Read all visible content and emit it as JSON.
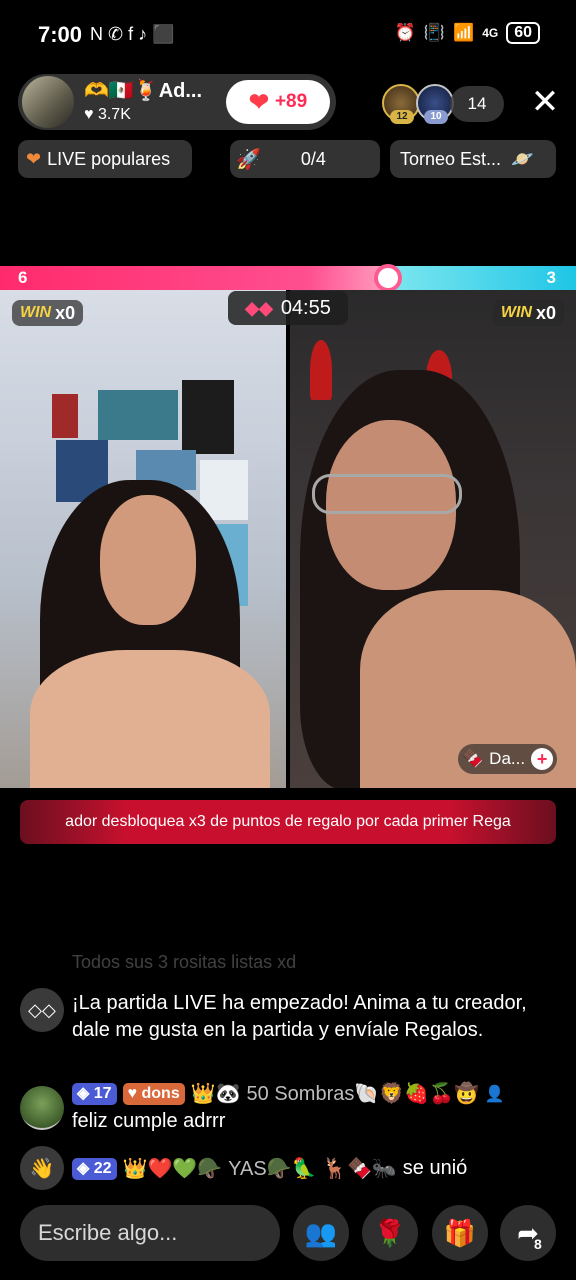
{
  "status_bar": {
    "time": "7:00",
    "left_icons": "N ✆ f ♪ ⬛",
    "network": "4G",
    "battery": "60"
  },
  "host": {
    "name": "🫶🇲🇽🍹Ad...",
    "likes": "♥ 3.7K",
    "follow_count": "+89"
  },
  "viewers": {
    "badge_1": "12",
    "badge_2": "10",
    "count": "14"
  },
  "chips": {
    "live_popular": "LIVE populares",
    "progress": "0/4",
    "tournament": "Torneo Est..."
  },
  "battle": {
    "score_left": "6",
    "score_right": "3",
    "timer": "04:55",
    "win_label": "WIN",
    "left_win": "x0",
    "right_win": "x0",
    "gifter_name": "Da..."
  },
  "banner": {
    "text": "ador desbloquea x3 de puntos de regalo por cada primer Rega"
  },
  "chat": {
    "faded": "Todos sus 3 rositas listas xd",
    "system_message": "¡La partida LIVE ha empezado! Anima a tu creador, dale me gusta en la partida y envíale Regalos.",
    "msg1": {
      "level": "17",
      "fan": "dons",
      "emojis": "👑🐼",
      "username": "50 Sombras🐚🦁🍓🍒🤠",
      "text": "feliz cumple adrrr"
    },
    "msg2": {
      "level": "22",
      "emojis": "👑❤️💚🪖",
      "username": "YAS🪖🦜 🦌🍫🐜",
      "text": "se unió"
    }
  },
  "bottom": {
    "placeholder": "Escribe algo...",
    "share_count": "8"
  },
  "colors": {
    "red_team": "#ff2a6d",
    "blue_team": "#1fc6e6",
    "accent": "#fe2c55"
  }
}
